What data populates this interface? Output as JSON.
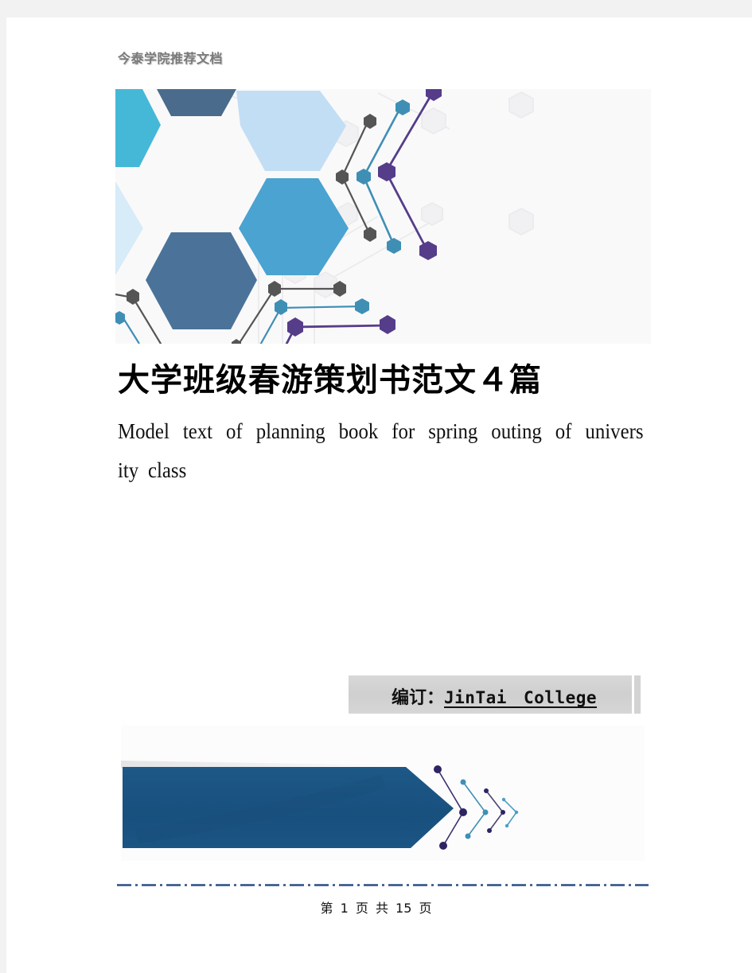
{
  "document": {
    "header": "今泰学院推荐文档",
    "title": "大学班级春游策划书范文４篇",
    "subtitle_line1": "Model text of planning book for spring outing of univers",
    "subtitle_line2": "ity class",
    "compiler_label": "编订：",
    "compiler_name": "JinTai  College",
    "page_number": {
      "text": "第 1 页 共 15 页",
      "current": 1,
      "total": 15
    }
  },
  "colors": {
    "hex_cyan": "#45b8d8",
    "hex_navy": "#4a6b8c",
    "hex_light_blue": "#c2def5",
    "hex_mid_blue": "#4aa3d0",
    "hex_steel": "#4b7399",
    "hex_pale": "#d7ebf8",
    "node_gray": "#555555",
    "node_teal": "#3f8fb5",
    "node_purple": "#553d8a",
    "banner_blue": "#1b5583",
    "divider_blue": "#2c4f86"
  },
  "icons": {
    "hero_graphic": "hexagon-network-graphic",
    "banner_graphic": "arrow-chevron-graphic"
  }
}
